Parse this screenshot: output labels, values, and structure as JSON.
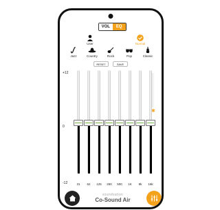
{
  "segment": {
    "vol_label": "VOL",
    "eq_label": "EQ"
  },
  "modes": {
    "user": {
      "label": "User",
      "icon": "user-icon"
    },
    "normal": {
      "label": "Normal",
      "icon": "check-circle-icon"
    }
  },
  "presets": [
    {
      "label": "Jazz",
      "icon": "saxophone-icon"
    },
    {
      "label": "Country",
      "icon": "cowboy-hat-icon"
    },
    {
      "label": "Rock",
      "icon": "guitar-icon"
    },
    {
      "label": "Pop",
      "icon": "sunglasses-icon"
    },
    {
      "label": "Classic",
      "icon": "violin-icon"
    }
  ],
  "buttons": {
    "reset": "RESET",
    "save": "SAVE"
  },
  "scale": {
    "top": "+12",
    "mid": "0",
    "bottom": "-12"
  },
  "bands": [
    {
      "freq": "31",
      "gain": 0
    },
    {
      "freq": "62",
      "gain": 0
    },
    {
      "freq": "125",
      "gain": 0
    },
    {
      "freq": "250",
      "gain": 0
    },
    {
      "freq": "500",
      "gain": 0
    },
    {
      "freq": "1K",
      "gain": 0
    },
    {
      "freq": "8k",
      "gain": 0
    },
    {
      "freq": "16k",
      "gain": 0
    }
  ],
  "brand": {
    "top": "soundsation",
    "main": "Co-Sound Air"
  },
  "navbar": {
    "recent": "|||",
    "home": "◯",
    "back": "<"
  },
  "colors": {
    "accent": "#f4a21b",
    "dark": "#222222"
  }
}
